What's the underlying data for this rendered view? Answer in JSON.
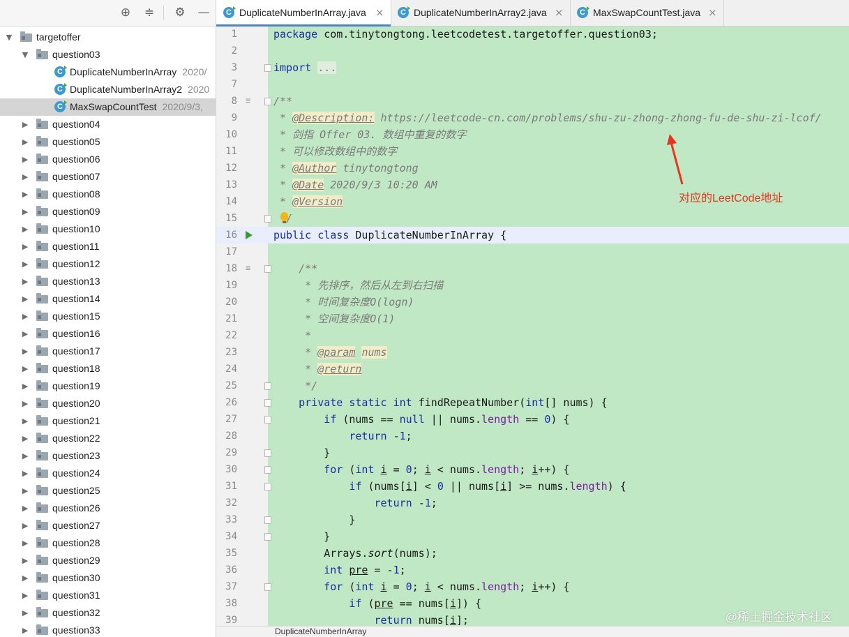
{
  "sidebar": {
    "toolbar": {
      "locate_icon": "crosshair-icon",
      "collapse_icon": "collapse-icon",
      "settings_icon": "gear-icon",
      "hide_icon": "minus-icon"
    },
    "root": "targetoffer",
    "open_folder": "question03",
    "files": [
      {
        "name": "DuplicateNumberInArray",
        "date": "2020/"
      },
      {
        "name": "DuplicateNumberInArray2",
        "date": "2020"
      },
      {
        "name": "MaxSwapCountTest",
        "date": "2020/9/3,"
      }
    ],
    "folders": [
      "question04",
      "question05",
      "question06",
      "question07",
      "question08",
      "question09",
      "question10",
      "question11",
      "question12",
      "question13",
      "question14",
      "question15",
      "question16",
      "question17",
      "question18",
      "question19",
      "question20",
      "question21",
      "question22",
      "question23",
      "question24",
      "question25",
      "question26",
      "question27",
      "question28",
      "question29",
      "question30",
      "question31",
      "question32",
      "question33"
    ]
  },
  "tabs": [
    {
      "label": "DuplicateNumberInArray.java",
      "active": true
    },
    {
      "label": "DuplicateNumberInArray2.java",
      "active": false
    },
    {
      "label": "MaxSwapCountTest.java",
      "active": false
    }
  ],
  "tab_close_glyph": "×",
  "code_lines": [
    {
      "n": "1",
      "html": "<span class=\"kw\">package</span> com.tinytongtong.leetcodetest.targetoffer.question03;"
    },
    {
      "n": "2",
      "html": ""
    },
    {
      "n": "3",
      "html": "<span class=\"kw\">import</span> <span class=\"cm\" style=\"font-style:normal;background:#dfeedf\">...</span>"
    },
    {
      "n": "7",
      "html": ""
    },
    {
      "n": "8",
      "html": "<span class=\"cm\">/**</span>"
    },
    {
      "n": "9",
      "html": "<span class=\"cm\"> * <span class=\"tag\">@Description:</span> https://leetcode-cn.com/problems/shu-zu-zhong-zhong-fu-de-shu-zi-lcof/</span>"
    },
    {
      "n": "10",
      "html": "<span class=\"cm\"> * 剑指 Offer 03. 数组中重复的数字</span>"
    },
    {
      "n": "11",
      "html": "<span class=\"cm\"> * 可以修改数组中的数字</span>"
    },
    {
      "n": "12",
      "html": "<span class=\"cm\"> * <span class=\"tag\">@Author</span> tinytongtong</span>"
    },
    {
      "n": "13",
      "html": "<span class=\"cm\"> * <span class=\"tag\">@Date</span> 2020/9/3 10:20 AM</span>"
    },
    {
      "n": "14",
      "html": "<span class=\"cm\"> * <span class=\"tag\">@Version</span></span>"
    },
    {
      "n": "15",
      "html": "<span class=\"cm\">  /</span>"
    },
    {
      "n": "16",
      "html": "<span class=\"kw\">public class</span> DuplicateNumberInArray {"
    },
    {
      "n": "17",
      "html": ""
    },
    {
      "n": "18",
      "html": "    <span class=\"cm\">/**</span>"
    },
    {
      "n": "19",
      "html": "<span class=\"cm\">     * 先排序，然后从左到右扫描</span>"
    },
    {
      "n": "20",
      "html": "<span class=\"cm\">     * 时间复杂度O(logn)</span>"
    },
    {
      "n": "21",
      "html": "<span class=\"cm\">     * 空间复杂度O(1)</span>"
    },
    {
      "n": "22",
      "html": "<span class=\"cm\">     *</span>"
    },
    {
      "n": "23",
      "html": "<span class=\"cm\">     * <span class=\"tag\">@param</span> <span style=\"background:#f2edc8\">nums</span></span>"
    },
    {
      "n": "24",
      "html": "<span class=\"cm\">     * <span class=\"tag\">@return</span></span>"
    },
    {
      "n": "25",
      "html": "<span class=\"cm\">     */</span>"
    },
    {
      "n": "26",
      "html": "    <span class=\"kw\">private static int</span> findRepeatNumber(<span class=\"kw\">int</span>[] nums) {"
    },
    {
      "n": "27",
      "html": "        <span class=\"kw\">if</span> (nums == <span class=\"kw\">null</span> || nums.<span class=\"fld\">length</span> == <span class=\"num\">0</span>) {"
    },
    {
      "n": "28",
      "html": "            <span class=\"kw\">return</span> -<span class=\"num\">1</span>;"
    },
    {
      "n": "29",
      "html": "        }"
    },
    {
      "n": "30",
      "html": "        <span class=\"kw\">for</span> (<span class=\"kw\">int</span> <u>i</u> = <span class=\"num\">0</span>; <u>i</u> &lt; nums.<span class=\"fld\">length</span>; <u>i</u>++) {"
    },
    {
      "n": "31",
      "html": "            <span class=\"kw\">if</span> (nums[<u>i</u>] &lt; <span class=\"num\">0</span> || nums[<u>i</u>] &gt;= nums.<span class=\"fld\">length</span>) {"
    },
    {
      "n": "32",
      "html": "                <span class=\"kw\">return</span> -<span class=\"num\">1</span>;"
    },
    {
      "n": "33",
      "html": "            }"
    },
    {
      "n": "34",
      "html": "        }"
    },
    {
      "n": "35",
      "html": "        Arrays.<i>sort</i>(nums);"
    },
    {
      "n": "36",
      "html": "        <span class=\"kw\">int</span> <u>pre</u> = -<span class=\"num\">1</span>;"
    },
    {
      "n": "37",
      "html": "        <span class=\"kw\">for</span> (<span class=\"kw\">int</span> <u>i</u> = <span class=\"num\">0</span>; <u>i</u> &lt; nums.<span class=\"fld\">length</span>; <u>i</u>++) {"
    },
    {
      "n": "38",
      "html": "            <span class=\"kw\">if</span> (<u>pre</u> == nums[<u>i</u>]) {"
    },
    {
      "n": "39",
      "html": "                <span class=\"kw\">return</span> nums[<u>i</u>];"
    }
  ],
  "annotation": "对应的LeetCode地址",
  "status_bar": "DuplicateNumberInArray",
  "watermark": "@稀土掘金技术社区"
}
